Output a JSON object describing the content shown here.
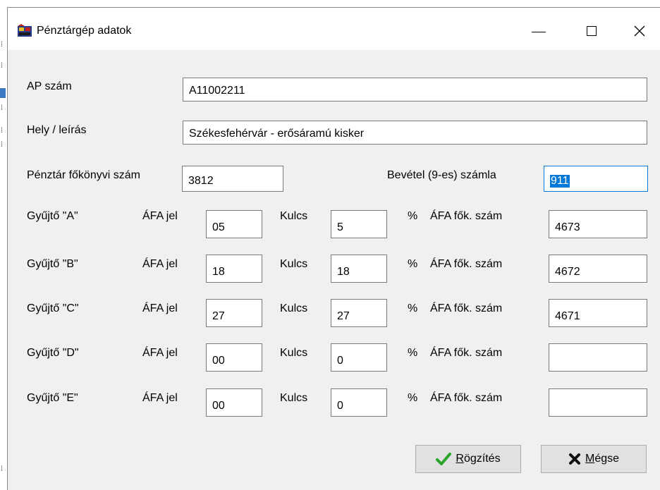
{
  "window": {
    "title": "Pénztárgép adatok"
  },
  "fields": {
    "ap_szam": {
      "label": "AP szám",
      "value": "A11002211"
    },
    "hely": {
      "label": "Hely / leírás",
      "value": "Székesfehérvár - erősáramú kisker"
    },
    "penztar": {
      "label": "Pénztár főkönyvi szám",
      "value": "3812"
    },
    "bevetel": {
      "label": "Bevétel (9-es) számla",
      "value": "911"
    }
  },
  "row_labels": {
    "afa_jel": "ÁFA jel",
    "kulcs": "Kulcs",
    "percent": "%",
    "afa_fok": "ÁFA fők. szám"
  },
  "rows": [
    {
      "name": "Gyűjtő \"A\"",
      "afa_jel": "05",
      "kulcs": "5",
      "afa_fok": "4673"
    },
    {
      "name": "Gyűjtő \"B\"",
      "afa_jel": "18",
      "kulcs": "18",
      "afa_fok": "4672"
    },
    {
      "name": "Gyűjtő \"C\"",
      "afa_jel": "27",
      "kulcs": "27",
      "afa_fok": "4671"
    },
    {
      "name": "Gyűjtő \"D\"",
      "afa_jel": "00",
      "kulcs": "0",
      "afa_fok": ""
    },
    {
      "name": "Gyűjtő \"E\"",
      "afa_jel": "00",
      "kulcs": "0",
      "afa_fok": ""
    }
  ],
  "buttons": {
    "save": {
      "mnemonic": "R",
      "rest": "ögzítés"
    },
    "cancel": {
      "mnemonic": "M",
      "rest": "égse"
    }
  },
  "colors": {
    "accent": "#0078d7",
    "check": "#2aa52a",
    "cross": "#111111"
  }
}
